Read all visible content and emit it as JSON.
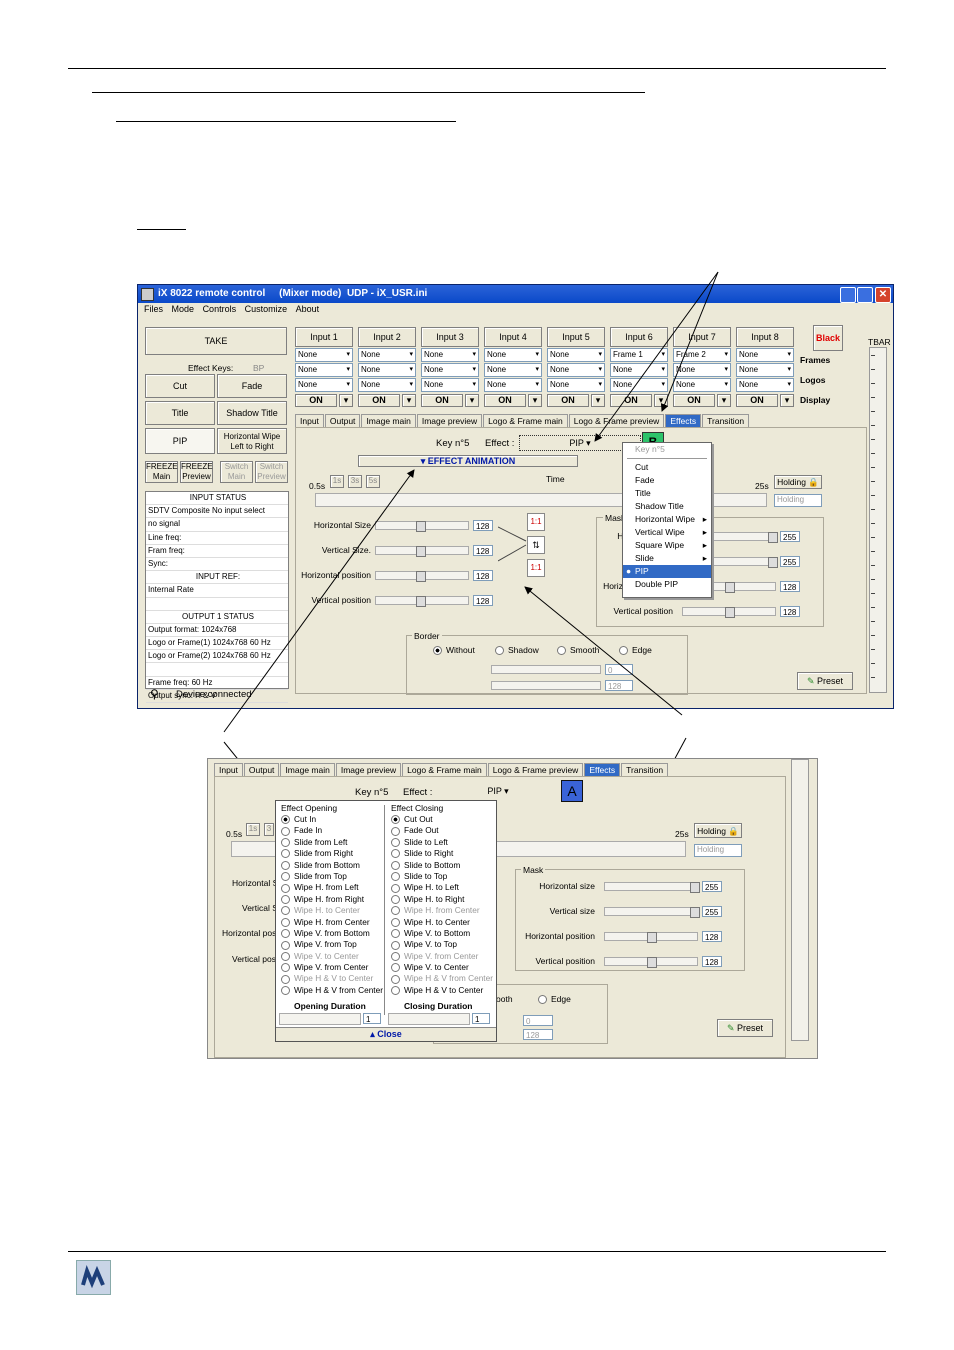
{
  "app_title": "iX 8022 remote control     (Mixer mode)  UDP - iX_USR.ini",
  "menu": [
    "Files",
    "Mode",
    "Controls",
    "Customize",
    "About"
  ],
  "left_panel": {
    "take": "TAKE",
    "effect_keys_label": "Effect Keys:",
    "effect_keys_value": "BP",
    "keys": [
      "Cut",
      "Fade",
      "Title",
      "Shadow Title",
      "PIP",
      "Horizontal Wipe Left to Right"
    ],
    "freeze_main": "FREEZE Main",
    "freeze_preview": "FREEZE Preview",
    "switch_main": "Switch Main",
    "switch_preview": "Switch Preview",
    "status_lines": [
      "INPUT STATUS",
      "SDTV Composite     No input      select",
      "no signal",
      "Line freq:",
      "Fram freq:",
      "Sync:",
      "INPUT REF:",
      "Internal Rate",
      "",
      "OUTPUT 1      STATUS",
      "Output format:     1024x768",
      "Logo or Frame(1)  1024x768        60 Hz",
      "Logo or Frame(2)  1024x768        60 Hz",
      "",
      "Frame freq:          60 Hz",
      "Output sync:         H & V"
    ],
    "device": "Device connected"
  },
  "inputs": [
    {
      "name": "Input 1",
      "frame": "None",
      "logo": "None",
      "display": "None",
      "on": "ON"
    },
    {
      "name": "Input 2",
      "frame": "None",
      "logo": "None",
      "display": "None",
      "on": "ON"
    },
    {
      "name": "Input 3",
      "frame": "None",
      "logo": "None",
      "display": "None",
      "on": "ON"
    },
    {
      "name": "Input 4",
      "frame": "None",
      "logo": "None",
      "display": "None",
      "on": "ON"
    },
    {
      "name": "Input 5",
      "frame": "None",
      "logo": "None",
      "display": "None",
      "on": "ON"
    },
    {
      "name": "Input 6",
      "frame": "Frame 1",
      "logo": "None",
      "display": "None",
      "on": "ON"
    },
    {
      "name": "Input 7",
      "frame": "Frame 2",
      "logo": "None",
      "display": "None",
      "on": "ON"
    },
    {
      "name": "Input 8",
      "frame": "None",
      "logo": "None",
      "display": "None",
      "on": "ON"
    }
  ],
  "black": "Black",
  "row_labels": [
    "Frames",
    "Logos",
    "Display"
  ],
  "tbar": "TBAR",
  "tabs": [
    "Input",
    "Output",
    "Image main",
    "Image preview",
    "Logo & Frame main",
    "Logo & Frame preview",
    "Effects",
    "Transition"
  ],
  "key_label": "Key n°5",
  "effect_label": "Effect :",
  "effect_value": "PIP",
  "key_letter1": "B",
  "key_letter2": "A",
  "effect_animation": "EFFECT ANIMATION",
  "time_label": "Time",
  "t_start": "0.5s",
  "t_end": "25s",
  "t_steps": [
    "1s",
    "3",
    "3s",
    "5s"
  ],
  "holding": "Holding",
  "holding_field": "Holding",
  "sliders": [
    {
      "label": "Horizontal Size",
      "value": "128"
    },
    {
      "label": "Vertical Size.",
      "value": "128"
    },
    {
      "label": "Horizontal position",
      "value": "128"
    },
    {
      "label": "Vertical position",
      "value": "128"
    }
  ],
  "mask_label": "Mask",
  "mask_sliders": [
    {
      "label": "Horizontal size",
      "value": "255"
    },
    {
      "label": "Vertical size",
      "value": "255"
    },
    {
      "label": "Horizontal position",
      "value": "128"
    },
    {
      "label": "Vertical position",
      "value": "128"
    }
  ],
  "border_label": "Border",
  "border_opts": [
    "Without",
    "Shadow",
    "Smooth",
    "Edge"
  ],
  "border_vals": [
    "0",
    "128"
  ],
  "preset": "Preset",
  "effect_menu": {
    "header": "Key n°5",
    "items": [
      "Cut",
      "Fade",
      "Title",
      "Shadow Title",
      "Horizontal Wipe",
      "Vertical Wipe",
      "Square Wipe",
      "Slide",
      "PIP",
      "Double PIP"
    ]
  },
  "second": {
    "opening_title": "Effect Opening",
    "closing_title": "Effect Closing",
    "opening": [
      "Cut In",
      "Fade In",
      "Slide from Left",
      "Slide from Right",
      "Slide from Bottom",
      "Slide from Top",
      "Wipe H. from Left",
      "Wipe H. from Right",
      "Wipe H. to Center",
      "Wipe H. from Center",
      "Wipe V. from Bottom",
      "Wipe V. from Top",
      "Wipe V. to Center",
      "Wipe V. from Center",
      "Wipe H & V to Center",
      "Wipe H & V from Center"
    ],
    "closing": [
      "Cut Out",
      "Fade Out",
      "Slide to Left",
      "Slide to Right",
      "Slide to Bottom",
      "Slide to Top",
      "Wipe H. to Left",
      "Wipe H. to Right",
      "Wipe H. from Center",
      "Wipe H. to Center",
      "Wipe V. to Bottom",
      "Wipe V. to Top",
      "Wipe V. from Center",
      "Wipe V. to Center",
      "Wipe H & V from Center",
      "Wipe H & V to Center"
    ],
    "opening_duration": "Opening Duration",
    "closing_duration": "Closing Duration",
    "dur_value": "1",
    "close": "Close",
    "left_labels": [
      "Horizontal S",
      "Vertical S",
      "Horizontal pos",
      "Vertical pos"
    ],
    "smooth": "ooth",
    "edge": "Edge",
    "border_vals": [
      "0",
      "128"
    ]
  }
}
